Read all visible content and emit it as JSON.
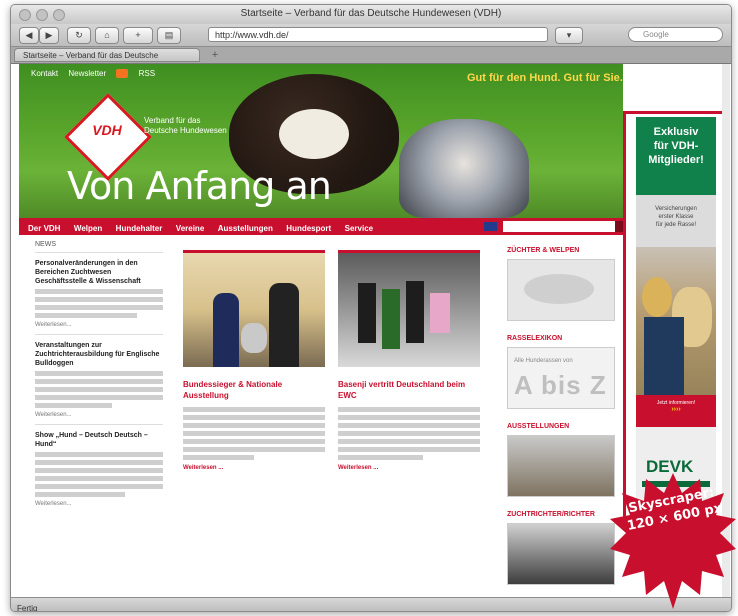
{
  "browser": {
    "window_title": "Startseite – Verband für das Deutsche Hundewesen (VDH)",
    "url": "http://www.vdh.de/",
    "search_placeholder": "Google",
    "tab_title": "Startseite – Verband für das Deutsche Hundewesen",
    "status": "Fertig"
  },
  "header": {
    "top_links": [
      "Kontakt",
      "Newsletter",
      "RSS"
    ],
    "slogan": "Gut für den Hund. Gut für Sie.",
    "logo": "VDH",
    "logo_subtitle": "Verband für das Deutsche Hundewesen",
    "hero_title": "Von Anfang an"
  },
  "nav": {
    "items": [
      "Der VDH",
      "Welpen",
      "Hundehalter",
      "Vereine",
      "Ausstellungen",
      "Hundesport",
      "Service"
    ]
  },
  "news": {
    "heading": "NEWS",
    "items": [
      {
        "title": "Personalveränderungen in den Bereichen Zuchtwesen Geschäftsstelle & Wissenschaft",
        "more": "Weiterlesen..."
      },
      {
        "title": "Veranstaltungen zur Zuchtrichterausbildung für Englische Bulldoggen",
        "more": "Weiterlesen..."
      },
      {
        "title": "Show „Hund – Deutsch Deutsch – Hund“",
        "more": "Weiterlesen..."
      }
    ]
  },
  "cards": [
    {
      "title": "Bundessieger & Nationale Ausstellung",
      "link": "Weiterlesen ..."
    },
    {
      "title": "Basenji vertritt Deutschland beim EWC",
      "link": "Weiterlesen ..."
    }
  ],
  "sidebar": {
    "sections": [
      "ZÜCHTER & WELPEN",
      "RASSELEXIKON",
      "AUSSTELLUNGEN",
      "ZUCHTRICHTER/RICHTER"
    ],
    "lexikon_small": "Alle Hunderassen von",
    "lexikon_big": "A bis Z"
  },
  "skyscraper": {
    "headline": [
      "Exklusiv",
      "für VDH-",
      "Mitglieder!"
    ],
    "tagline": [
      "Versicherungen",
      "erster Klasse",
      "für jede Rasse!"
    ],
    "cta": "Jetzt informieren!",
    "arrows": "››››",
    "brand": "DEVK"
  },
  "callout": {
    "line1": "Skyscraper:",
    "line2": "120 × 600 px"
  }
}
